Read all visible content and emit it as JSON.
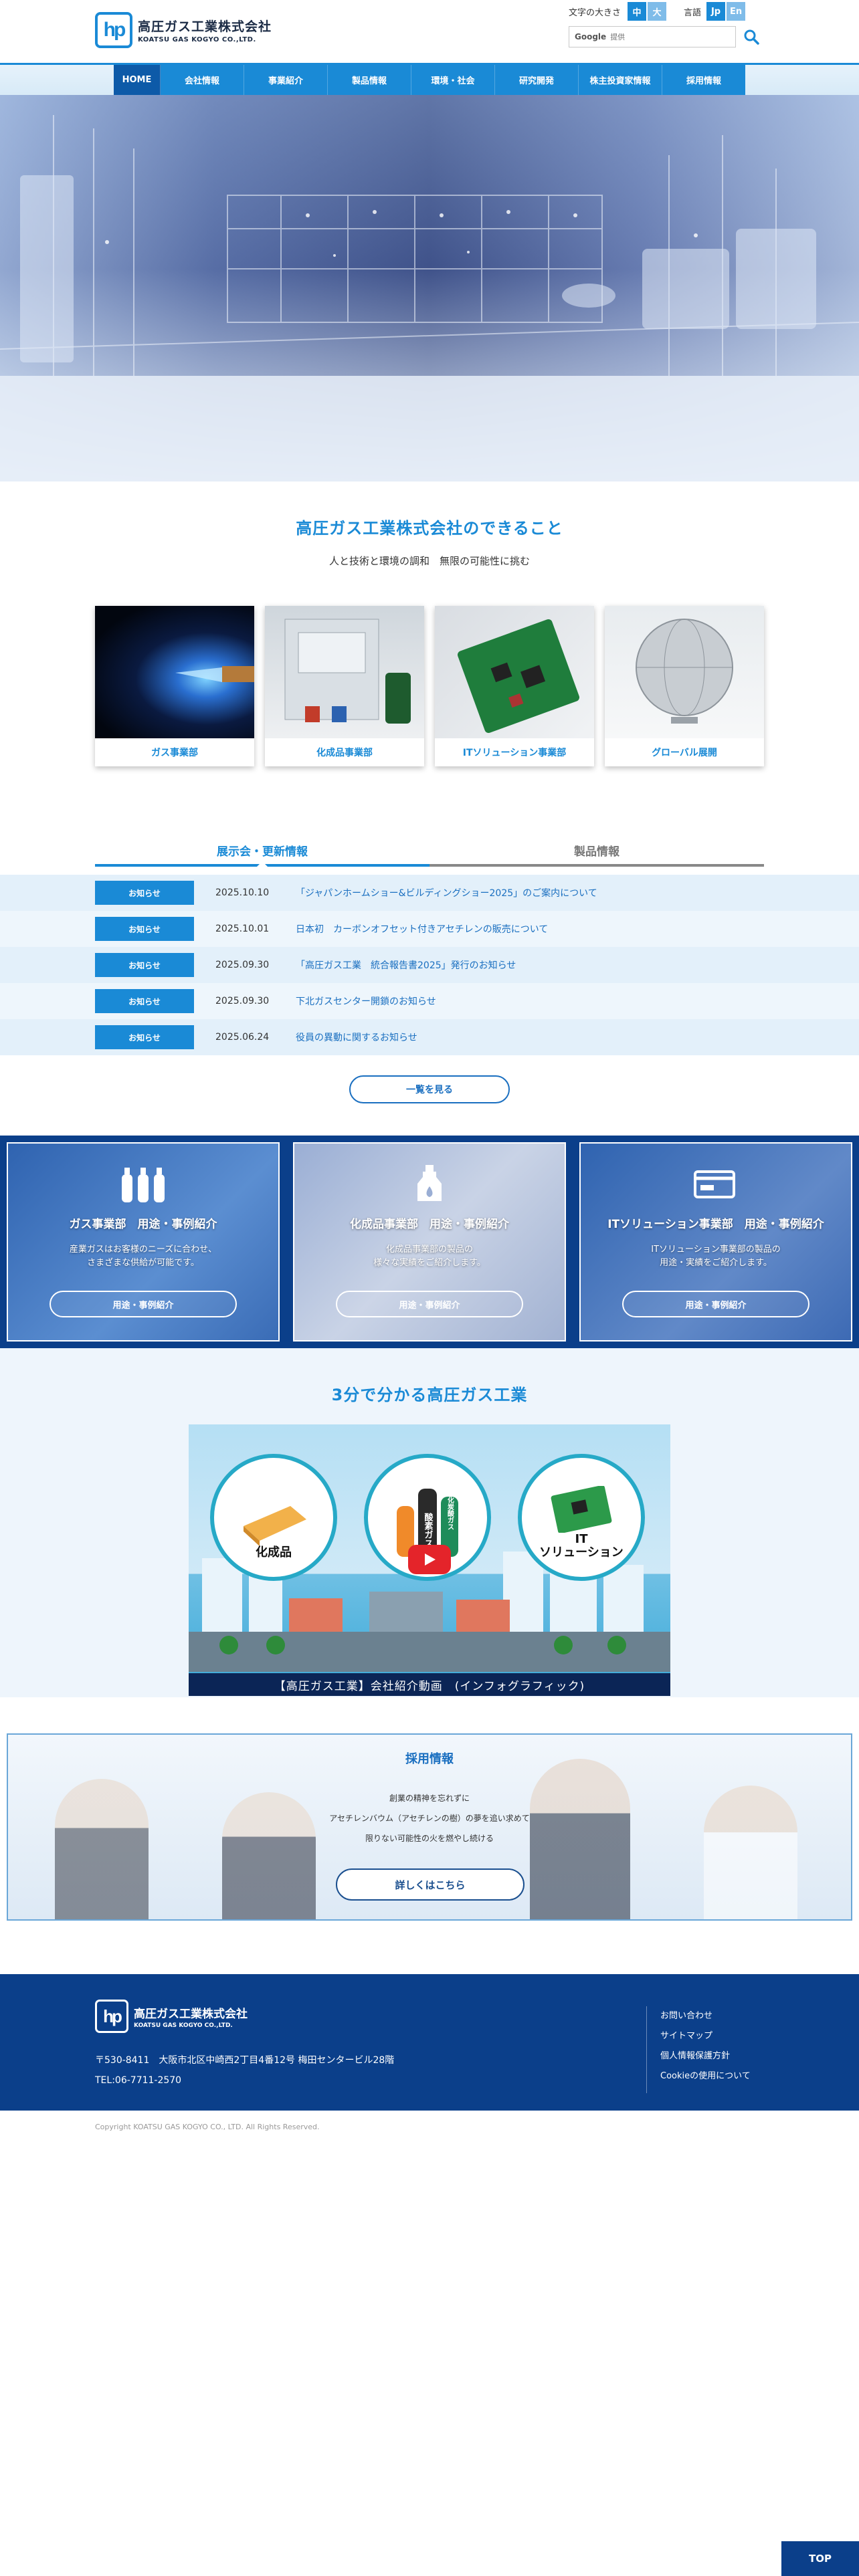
{
  "header": {
    "logo_jp": "高圧ガス工業株式会社",
    "logo_en": "KOATSU GAS KOGYO CO.,LTD.",
    "font_size_label": "文字の大きさ",
    "font_size_mid": "中",
    "font_size_large": "大",
    "language_label": "言語",
    "lang_jp": "Jp",
    "lang_en": "En",
    "search_brand": "Google",
    "search_placeholder": "提供"
  },
  "nav": {
    "items": [
      "HOME",
      "会社情報",
      "事業紹介",
      "製品情報",
      "環境・社会",
      "研究開発",
      "株主投資家情報",
      "採用情報"
    ]
  },
  "intro": {
    "title": "高圧ガス工業株式会社のできること",
    "subtitle": "人と技術と環境の調和　無限の可能性に挑む"
  },
  "business_cards": [
    {
      "label": "ガス事業部"
    },
    {
      "label": "化成品事業部"
    },
    {
      "label": "ITソリューション事業部"
    },
    {
      "label": "グローバル展開"
    }
  ],
  "tabs": {
    "active": "展示会・更新情報",
    "inactive": "製品情報"
  },
  "news": [
    {
      "tag": "お知らせ",
      "date": "2025.10.10",
      "title": "「ジャパンホームショー&ビルディングショー2025」のご案内について"
    },
    {
      "tag": "お知らせ",
      "date": "2025.10.01",
      "title": "日本初　カーボンオフセット付きアセチレンの販売について"
    },
    {
      "tag": "お知らせ",
      "date": "2025.09.30",
      "title": "「高圧ガス工業　統合報告書2025」発行のお知らせ"
    },
    {
      "tag": "お知らせ",
      "date": "2025.09.30",
      "title": "下北ガスセンター開鎖のお知らせ"
    },
    {
      "tag": "お知らせ",
      "date": "2025.06.24",
      "title": "役員の異動に関するお知らせ"
    }
  ],
  "more_button": "一覧を見る",
  "use_cases": [
    {
      "title": "ガス事業部　用途・事例紹介",
      "desc": "産業ガスはお客様のニーズに合わせ、\nさまざまな供給が可能です。",
      "button": "用途・事例紹介"
    },
    {
      "title": "化成品事業部　用途・事例紹介",
      "desc": "化成品事業部の製品の\n様々な実績をご紹介します。",
      "button": "用途・事例紹介"
    },
    {
      "title": "ITソリューション事業部　用途・事例紹介",
      "desc": "ITソリューション事業部の製品の\n用途・実績をご紹介します。",
      "button": "用途・事例紹介"
    }
  ],
  "video": {
    "title": "3分で分かる高圧ガス工業",
    "caption": "【高圧ガス工業】会社紹介動画　(インフォグラフィック)",
    "circle1": "化成品",
    "circle2_a": "酸素ガス",
    "circle2_b": "液化炭酸ガス",
    "circle3": "IT\nソリューション"
  },
  "recruit": {
    "title": "採用情報",
    "line1": "創業の精神を忘れずに",
    "line2": "アセチレンバウム（アセチレンの樹）の夢を追い求めて",
    "line3": "限りない可能性の火を燃やし続ける",
    "button": "詳しくはこちら"
  },
  "footer": {
    "logo_jp": "高圧ガス工業株式会社",
    "logo_en": "KOATSU GAS KOGYO CO.,LTD.",
    "address": "〒530-8411　大阪市北区中崎西2丁目4番12号 梅田センタービル28階",
    "tel": "TEL:06-7711-2570",
    "links": [
      "お問い合わせ",
      "サイトマップ",
      "個人情報保護方針",
      "Cookieの使用について"
    ]
  },
  "copyright": "Copyright KOATSU GAS KOGYO CO., LTD. All Rights Reserved.",
  "top_button": "TOP",
  "colors": {
    "brand_blue": "#1a8ad6",
    "dark_navy": "#0b3f8a",
    "news_link": "#1a6fc0"
  }
}
